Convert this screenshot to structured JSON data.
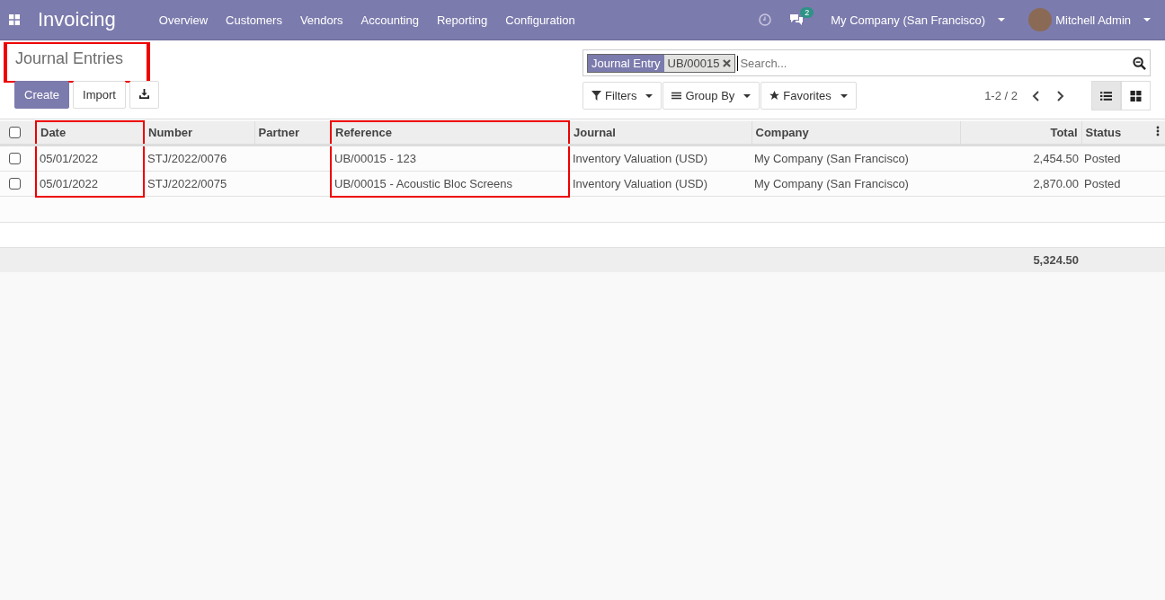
{
  "app": {
    "name": "Invoicing"
  },
  "menu": [
    "Overview",
    "Customers",
    "Vendors",
    "Accounting",
    "Reporting",
    "Configuration"
  ],
  "systray": {
    "messages_count": "2",
    "company": "My Company (San Francisco)",
    "user": "Mitchell Admin"
  },
  "breadcrumb": {
    "title": "Journal Entries",
    "highlighted": true
  },
  "buttons": [
    "Create",
    "Import"
  ],
  "search": {
    "facets": [
      {
        "label": "Journal Entry",
        "value": "UB/00015"
      }
    ],
    "placeholder": "Search..."
  },
  "filters": [
    {
      "label": "Filters",
      "kind": "filter"
    },
    {
      "label": "Group By",
      "kind": "group"
    },
    {
      "label": "Favorites",
      "kind": "star"
    }
  ],
  "pager": "1-2 / 2",
  "views": [
    {
      "kind": "list",
      "selected": true
    },
    {
      "kind": "kanban",
      "selected": false
    }
  ],
  "table": {
    "select_all": {
      "checked": false
    },
    "columns": [
      {
        "label": "Date",
        "kind": "text",
        "highlighted": true
      },
      {
        "label": "Number",
        "kind": "text",
        "highlighted": false
      },
      {
        "label": "Partner",
        "kind": "text",
        "highlighted": false
      },
      {
        "label": "Reference",
        "kind": "text",
        "highlighted": true
      },
      {
        "label": "Journal",
        "kind": "text",
        "highlighted": false
      },
      {
        "label": "Company",
        "kind": "text",
        "highlighted": false
      },
      {
        "label": "Total",
        "kind": "number",
        "highlighted": false
      },
      {
        "label": "Status",
        "kind": "text",
        "highlighted": false
      }
    ],
    "rows": [
      {
        "selected": false,
        "cells": [
          "05/01/2022",
          "STJ/2022/0076",
          "",
          "UB/00015 - 123",
          "Inventory Valuation (USD)",
          "My Company (San Francisco)",
          "2,454.50",
          "Posted"
        ]
      },
      {
        "selected": false,
        "cells": [
          "05/01/2022",
          "STJ/2022/0075",
          "",
          "UB/00015 - Acoustic Bloc Screens",
          "Inventory Valuation (USD)",
          "My Company (San Francisco)",
          "2,870.00",
          "Posted"
        ]
      }
    ],
    "total": "5,324.50"
  }
}
